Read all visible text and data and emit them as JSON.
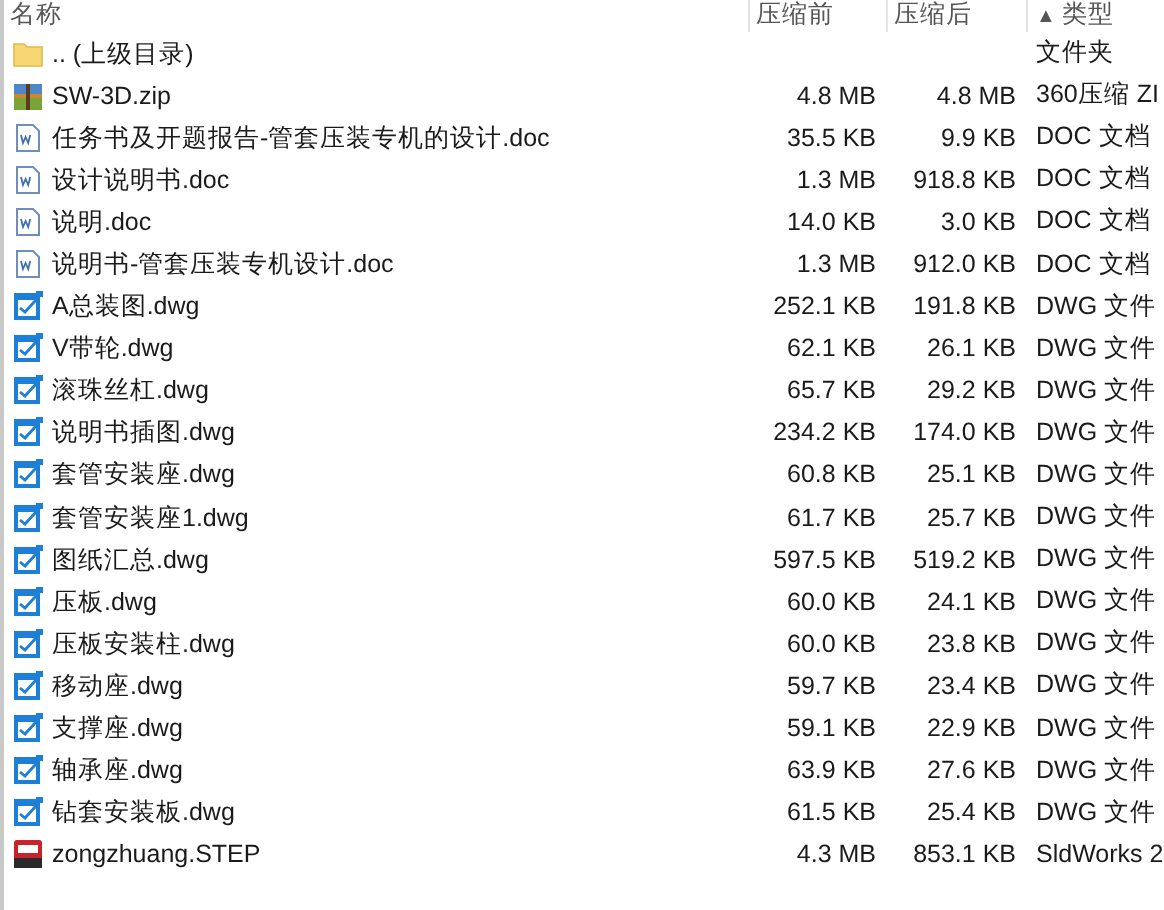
{
  "columns": [
    {
      "label": "名称"
    },
    {
      "label": "压缩前"
    },
    {
      "label": "压缩后"
    },
    {
      "label": "类型",
      "sort_arrow": "▲"
    }
  ],
  "rows": [
    {
      "kind": "folder",
      "name": ".. (上级目录)",
      "size": "",
      "packed": "",
      "type": "文件夹"
    },
    {
      "kind": "zip",
      "name": "SW-3D.zip",
      "size": "4.8 MB",
      "packed": "4.8 MB",
      "type": "360压缩 ZI"
    },
    {
      "kind": "doc",
      "name": "任务书及开题报告-管套压装专机的设计.doc",
      "size": "35.5 KB",
      "packed": "9.9 KB",
      "type": "DOC 文档"
    },
    {
      "kind": "doc",
      "name": "设计说明书.doc",
      "size": "1.3 MB",
      "packed": "918.8 KB",
      "type": "DOC 文档"
    },
    {
      "kind": "doc",
      "name": "说明.doc",
      "size": "14.0 KB",
      "packed": "3.0 KB",
      "type": "DOC 文档"
    },
    {
      "kind": "doc",
      "name": "说明书-管套压装专机设计.doc",
      "size": "1.3 MB",
      "packed": "912.0 KB",
      "type": "DOC 文档"
    },
    {
      "kind": "dwg",
      "name": "A总装图.dwg",
      "size": "252.1 KB",
      "packed": "191.8 KB",
      "type": "DWG 文件"
    },
    {
      "kind": "dwg",
      "name": "V带轮.dwg",
      "size": "62.1 KB",
      "packed": "26.1 KB",
      "type": "DWG 文件"
    },
    {
      "kind": "dwg",
      "name": "滚珠丝杠.dwg",
      "size": "65.7 KB",
      "packed": "29.2 KB",
      "type": "DWG 文件"
    },
    {
      "kind": "dwg",
      "name": "说明书插图.dwg",
      "size": "234.2 KB",
      "packed": "174.0 KB",
      "type": "DWG 文件"
    },
    {
      "kind": "dwg",
      "name": "套管安装座.dwg",
      "size": "60.8 KB",
      "packed": "25.1 KB",
      "type": "DWG 文件"
    },
    {
      "kind": "dwg",
      "name": "套管安装座1.dwg",
      "size": "61.7 KB",
      "packed": "25.7 KB",
      "type": "DWG 文件"
    },
    {
      "kind": "dwg",
      "name": "图纸汇总.dwg",
      "size": "597.5 KB",
      "packed": "519.2 KB",
      "type": "DWG 文件"
    },
    {
      "kind": "dwg",
      "name": "压板.dwg",
      "size": "60.0 KB",
      "packed": "24.1 KB",
      "type": "DWG 文件"
    },
    {
      "kind": "dwg",
      "name": "压板安装柱.dwg",
      "size": "60.0 KB",
      "packed": "23.8 KB",
      "type": "DWG 文件"
    },
    {
      "kind": "dwg",
      "name": "移动座.dwg",
      "size": "59.7 KB",
      "packed": "23.4 KB",
      "type": "DWG 文件"
    },
    {
      "kind": "dwg",
      "name": "支撑座.dwg",
      "size": "59.1 KB",
      "packed": "22.9 KB",
      "type": "DWG 文件"
    },
    {
      "kind": "dwg",
      "name": "轴承座.dwg",
      "size": "63.9 KB",
      "packed": "27.6 KB",
      "type": "DWG 文件"
    },
    {
      "kind": "dwg",
      "name": "钻套安装板.dwg",
      "size": "61.5 KB",
      "packed": "25.4 KB",
      "type": "DWG 文件"
    },
    {
      "kind": "step",
      "name": "zongzhuang.STEP",
      "size": "4.3 MB",
      "packed": "853.1 KB",
      "type": "SldWorks 2"
    }
  ]
}
